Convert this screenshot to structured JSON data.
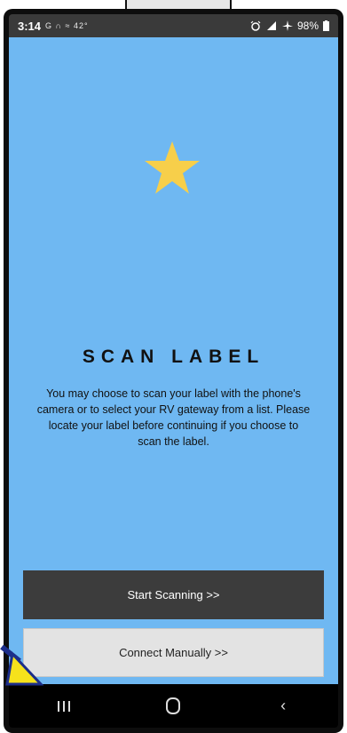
{
  "status_bar": {
    "time": "3:14",
    "left_icons": "G ∩ ≈ 42°",
    "battery": "98%"
  },
  "screen": {
    "title": "SCAN LABEL",
    "description": "You may choose to scan your label with the phone's camera or to select your RV gateway from a list. Please locate your label before continuing if you choose to scan the label."
  },
  "buttons": {
    "start_label": "Start Scanning >>",
    "manual_label": "Connect Manually >>"
  },
  "nav": {
    "back_glyph": "‹"
  },
  "colors": {
    "background": "#6fb8f2",
    "star": "#f7cf4a",
    "primary_button": "#3c3c3c",
    "secondary_button": "#e3e3e3"
  }
}
